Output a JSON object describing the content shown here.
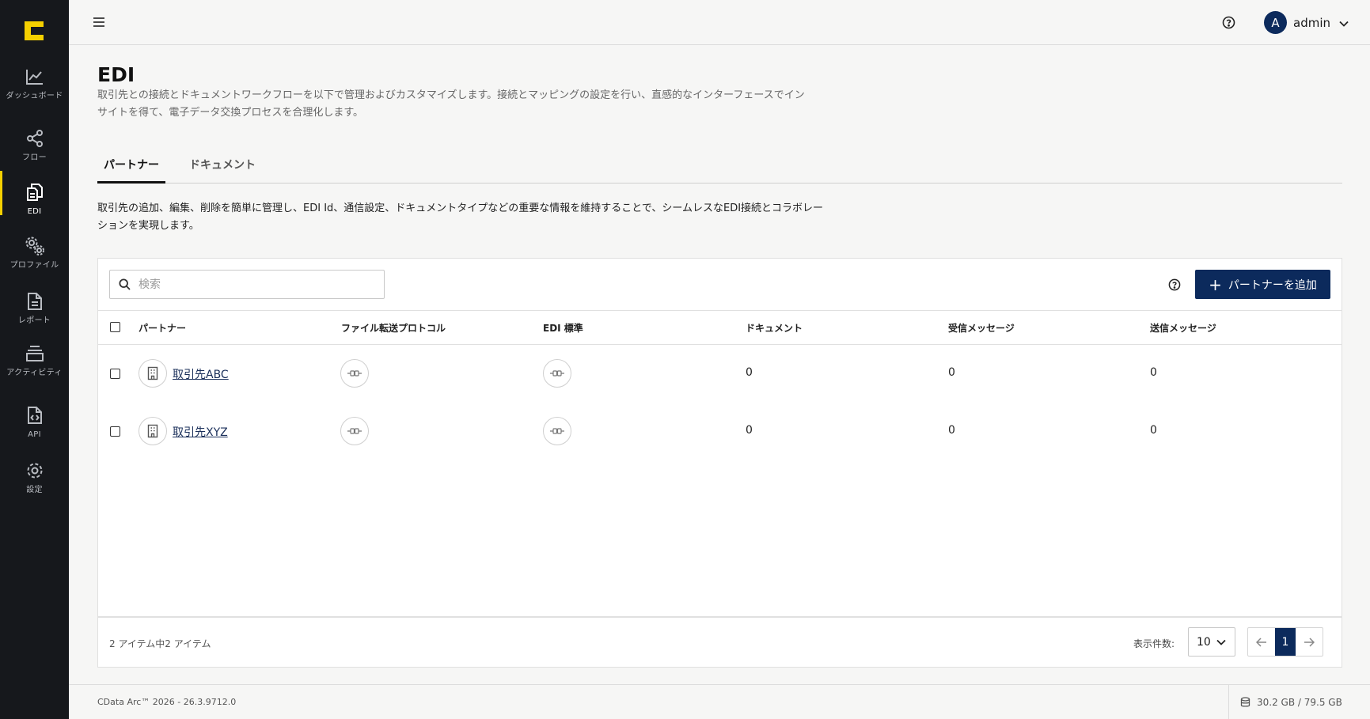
{
  "sidebar": {
    "items": [
      {
        "label": "ダッシュボード",
        "icon": "chart-line-icon"
      },
      {
        "label": "フロー",
        "icon": "share-nodes-icon"
      },
      {
        "label": "EDI",
        "icon": "documents-icon"
      },
      {
        "label": "プロファイル",
        "icon": "gears-icon"
      },
      {
        "label": "レポート",
        "icon": "report-document-icon"
      },
      {
        "label": "アクティビティ",
        "icon": "layers-icon"
      },
      {
        "label": "API",
        "icon": "code-file-icon"
      },
      {
        "label": "設定",
        "icon": "gear-icon"
      }
    ],
    "active_index": 2,
    "accent": "#f5d000"
  },
  "topbar": {
    "user_initial": "A",
    "user_name": "admin"
  },
  "page": {
    "title": "EDI",
    "description": "取引先との接続とドキュメントワークフローを以下で管理およびカスタマイズします。接続とマッピングの設定を行い、直感的なインターフェースでインサイトを得て、電子データ交換プロセスを合理化します。"
  },
  "tabs": [
    {
      "label": "パートナー",
      "active": true
    },
    {
      "label": "ドキュメント",
      "active": false
    }
  ],
  "section": {
    "description": "取引先の追加、編集、削除を簡単に管理し、EDI Id、通信設定、ドキュメントタイプなどの重要な情報を維持することで、シームレスなEDI接続とコラボレーションを実現します。"
  },
  "toolbar": {
    "search_placeholder": "検索",
    "add_button_label": "パートナーを追加"
  },
  "table": {
    "columns": [
      "パートナー",
      "ファイル転送プロトコル",
      "EDI 標準",
      "ドキュメント",
      "受信メッセージ",
      "送信メッセージ"
    ],
    "rows": [
      {
        "partner": "取引先ABC",
        "documents": "0",
        "received": "0",
        "sent": "0"
      },
      {
        "partner": "取引先XYZ",
        "documents": "0",
        "received": "0",
        "sent": "0"
      }
    ]
  },
  "pagination": {
    "summary": "2 アイテム中2 アイテム",
    "per_page_label": "表示件数:",
    "per_page_value": "10",
    "current_page": "1"
  },
  "footer": {
    "version": "CData Arc™ 2026 - 26.3.9712.0",
    "storage": "30.2 GB / 79.5 GB"
  },
  "colors": {
    "primary": "#0c2a5c",
    "sidebar_bg": "#16181c"
  }
}
